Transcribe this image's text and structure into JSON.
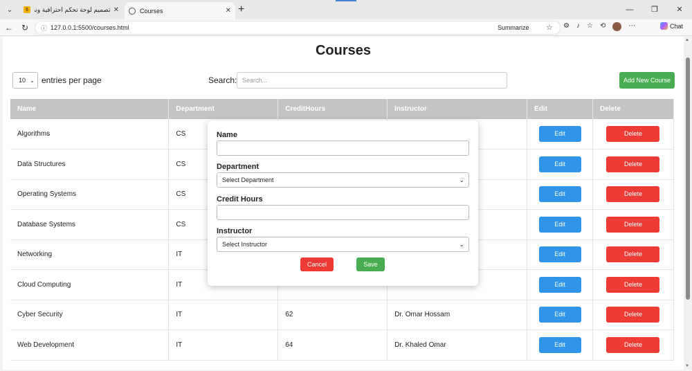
{
  "browser": {
    "tabs": [
      {
        "title": "تصميم لوحة تحكم احترافية ونظام إدا",
        "favicon": "5"
      },
      {
        "title": "Courses",
        "favicon": "globe"
      }
    ],
    "url": "127.0.0.1:5500/courses.html",
    "summarize_label": "Summarize",
    "chat_label": "Chat"
  },
  "page": {
    "title": "Courses",
    "entries": {
      "value": "10",
      "suffix": "entries per page"
    },
    "search": {
      "label": "Search:",
      "placeholder": "Search..."
    },
    "add_button": "Add New Course"
  },
  "table": {
    "headers": [
      "Name",
      "Department",
      "CreditHours",
      "Instructor",
      "Edit",
      "Delete"
    ],
    "rows": [
      {
        "name": "Algorithms",
        "dept": "CS",
        "hours": "",
        "instructor": ""
      },
      {
        "name": "Data Structures",
        "dept": "CS",
        "hours": "",
        "instructor": ""
      },
      {
        "name": "Operating Systems",
        "dept": "CS",
        "hours": "",
        "instructor": ""
      },
      {
        "name": "Database Systems",
        "dept": "CS",
        "hours": "",
        "instructor": ""
      },
      {
        "name": "Networking",
        "dept": "IT",
        "hours": "",
        "instructor": ""
      },
      {
        "name": "Cloud Computing",
        "dept": "IT",
        "hours": "",
        "instructor": ""
      },
      {
        "name": "Cyber Security",
        "dept": "IT",
        "hours": "62",
        "instructor": "Dr. Omar Hossam"
      },
      {
        "name": "Web Development",
        "dept": "IT",
        "hours": "64",
        "instructor": "Dr. Khaled Omar"
      }
    ],
    "edit_label": "Edit",
    "delete_label": "Delete"
  },
  "modal": {
    "name_label": "Name",
    "department_label": "Department",
    "department_select": "Select Department",
    "credit_label": "Credit Hours",
    "instructor_label": "Instructor",
    "instructor_select": "Select Instructor",
    "cancel": "Cancel",
    "save": "Save"
  }
}
